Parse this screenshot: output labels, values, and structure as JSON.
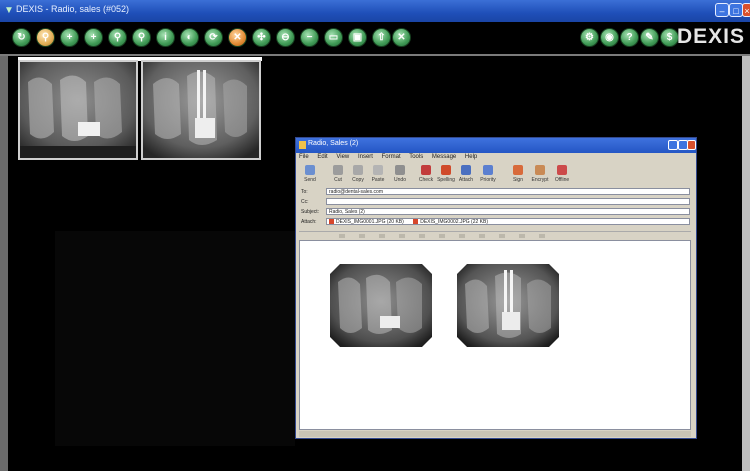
{
  "window": {
    "title": "DEXIS - Radio, sales (#052)"
  },
  "toolbar": {
    "brand": "DEXIS"
  },
  "email": {
    "title": "Radio, Sales (2)",
    "menu": [
      "File",
      "Edit",
      "View",
      "Insert",
      "Format",
      "Tools",
      "Message",
      "Help"
    ],
    "toolbar": [
      "Send",
      "Cut",
      "Copy",
      "Paste",
      "Undo",
      "Check",
      "Spelling",
      "Attach",
      "Priority",
      "Sign",
      "Encrypt",
      "Offline"
    ],
    "headers": {
      "to_label": "To:",
      "to_value": "radio@dental-sales.com",
      "cc_label": "Cc:",
      "cc_value": "",
      "subject_label": "Subject:",
      "subject_value": "Radio, Sales (2)",
      "attach_label": "Attach:",
      "attach1": "DEXIS_IMG0001.JPG (20 KB)",
      "attach2": "DEXIS_IMG0002.JPG (22 KB)"
    }
  },
  "colors": {
    "accent_green": "#3f9a55",
    "title_blue": "#2456c4",
    "brand": "#e6e6e6"
  }
}
